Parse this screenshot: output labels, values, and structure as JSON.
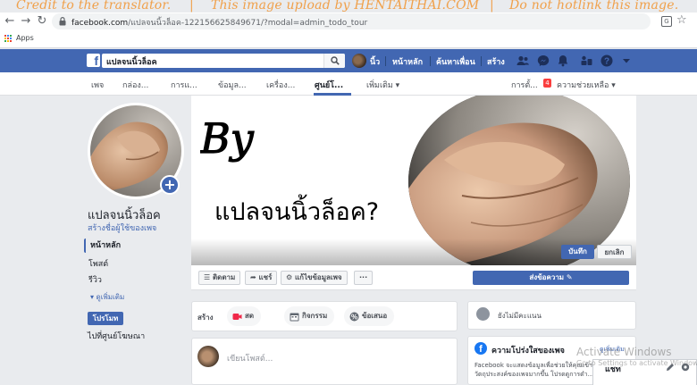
{
  "watermark": {
    "part1": "Credit to the translator.",
    "sep1": "|",
    "part2": "This image upload by HENTAITHAI.COM",
    "sep2": "|",
    "part3": "Do not hotlink this image."
  },
  "browser": {
    "url_host": "facebook.com",
    "url_path": "/แปลจนนิ้วล็อค-122156625849671/?modal=admin_todo_tour",
    "bookmarks": {
      "apps_label": "Apps"
    }
  },
  "topbar": {
    "search_value": "แปลจนนิ้วล็อค",
    "profile_name": "นิ้ว",
    "home": "หน้าหลัก",
    "find_friends": "ค้นหาเพื่อน",
    "create": "สร้าง"
  },
  "page_nav": {
    "items": [
      "เพจ",
      "กล่อง...",
      "การแ...",
      "ข้อมูล...",
      "เครื่อง...",
      "ศูนย์โ...",
      "เพิ่มเติม ▾"
    ],
    "active_index": 5,
    "settings": "การตั้...",
    "notifications_count": "4",
    "help": "ความช่วยเหลือ ▾"
  },
  "left": {
    "page_name": "แปลจนนิ้วล็อค",
    "create_username": "สร้างชื่อผู้ใช้ของเพจ",
    "nav": [
      "หน้าหลัก",
      "โพสต์",
      "รีวิว"
    ],
    "see_more": "▾  ดูเพิ่มเติม",
    "promote": "โปรโมท",
    "ads_center": "ไปที่ศูนย์โฆษณา"
  },
  "cover": {
    "by_text": "By",
    "headline": "แปลจนนิ้วล็อค?",
    "save": "บันทึก",
    "cancel": "ยกเลิก"
  },
  "actions": {
    "follow": "ติดตาม",
    "share": "แชร์",
    "edit_page_info": "แก้ไขข้อมูลเพจ",
    "more": "···",
    "send_message": "ส่งข้อความ"
  },
  "create_bar": {
    "label": "สร้าง",
    "live": "สด",
    "event": "กิจกรรม",
    "offer": "ข้อเสนอ"
  },
  "rating": {
    "text": "ยังไม่มีคะแนน"
  },
  "composer": {
    "placeholder": "เขียนโพสต์..."
  },
  "transparency": {
    "title": "ความโปร่งใสของเพจ",
    "see_more": "ดูเพิ่มเติม",
    "description": "Facebook จะแสดงข้อมูลเพื่อช่วยให้คุณเข้าใจวัตถุประสงค์ของเพจมากขึ้น โปรดดูการดำ..."
  },
  "chat": {
    "label": "แชท"
  },
  "os_overlay": {
    "line1": "Activate Windows",
    "line2": "Go to Settings to activate Windows."
  },
  "colors": {
    "fb_blue": "#4267b2",
    "watermark": "#f0a04a",
    "badge_red": "#fa3e3e"
  }
}
